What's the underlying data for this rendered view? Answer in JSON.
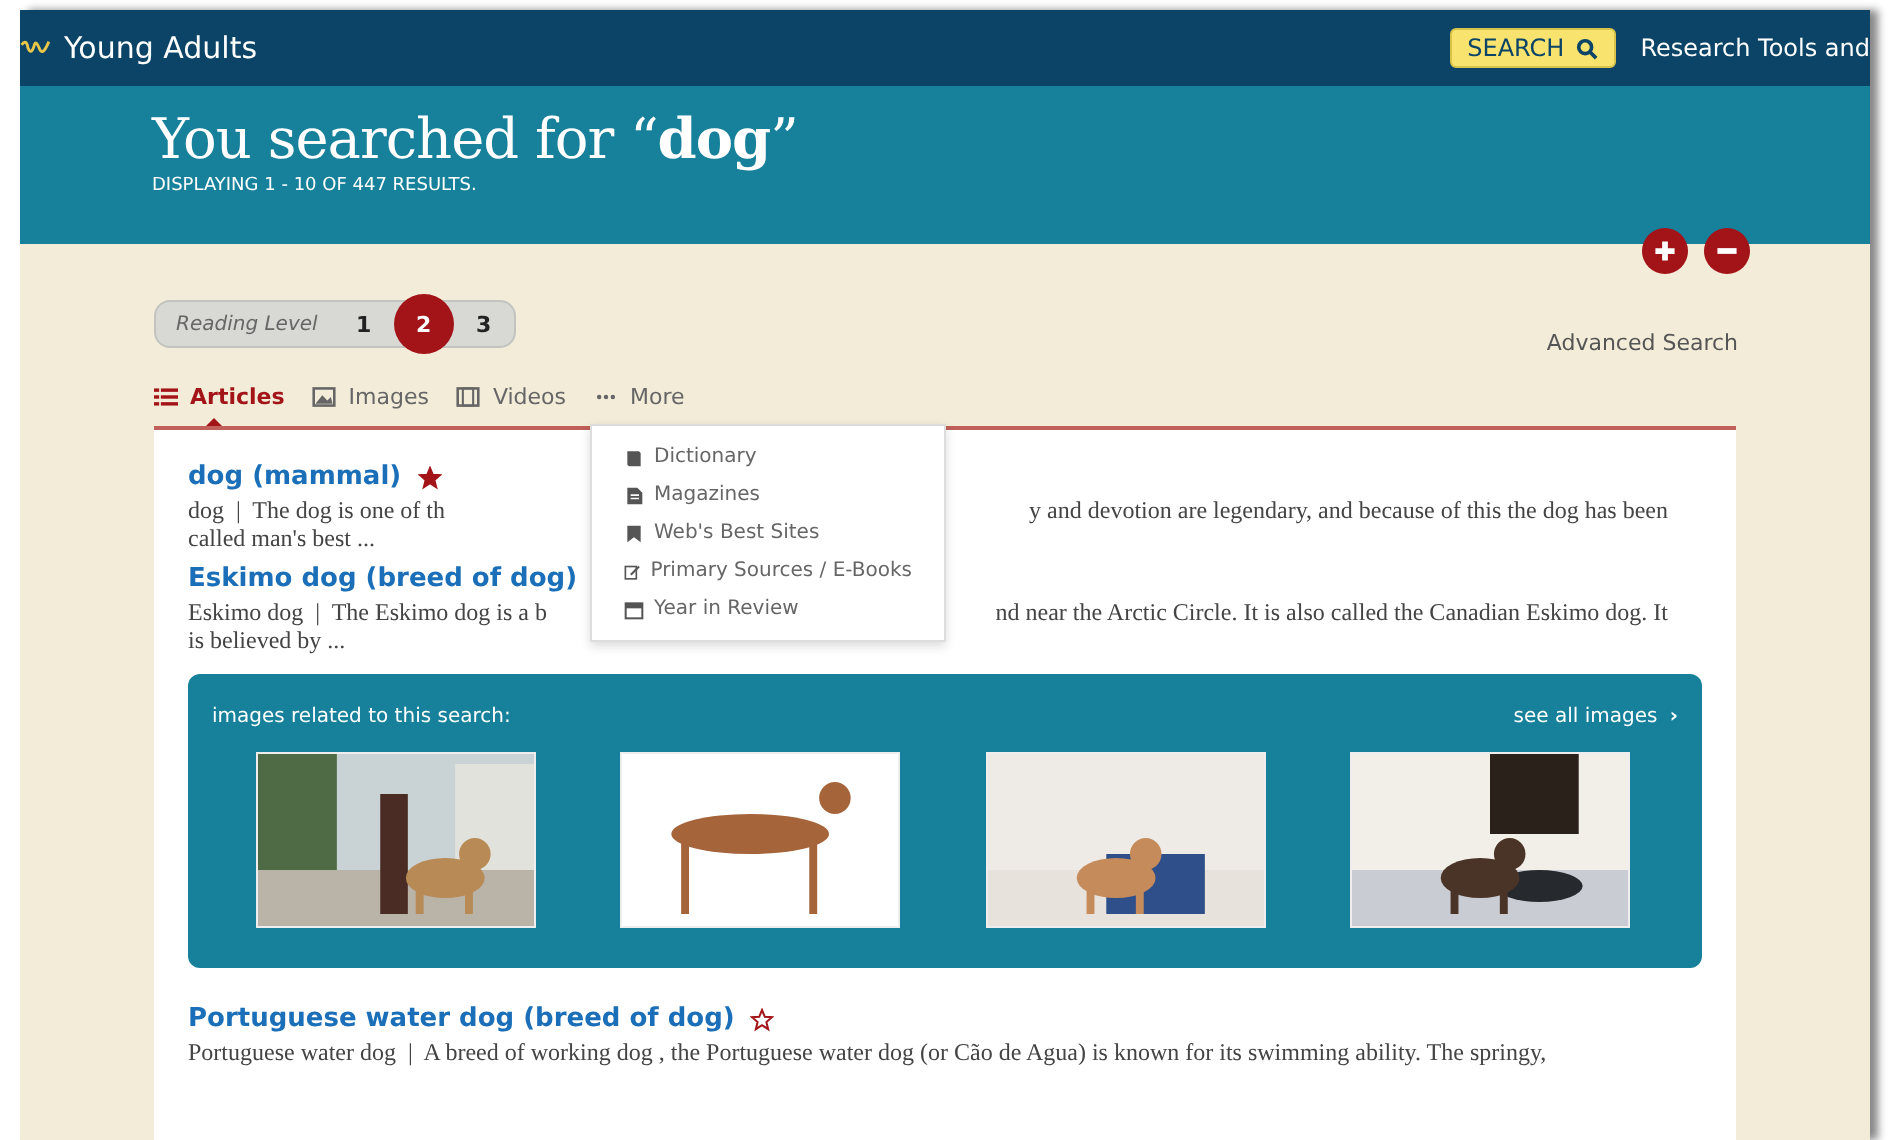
{
  "header": {
    "site": "Young Adults",
    "search_button": "SEARCH",
    "nav_link": "Research Tools and"
  },
  "banner": {
    "title": "You searched for “**dog**”",
    "results": "DISPLAYING 1 - 10 OF 447 RESULTS."
  },
  "reading_level": {
    "label": "Reading Level",
    "levels": [
      {
        "label": "1",
        "selected": false
      },
      {
        "label": "2",
        "selected": true
      },
      {
        "label": "3",
        "selected": false
      }
    ]
  },
  "advanced_search": "Advanced Search",
  "tabs": [
    {
      "label": "Articles",
      "selected": true
    },
    {
      "label": "Images",
      "selected": false
    },
    {
      "label": "Videos",
      "selected": false
    },
    {
      "label": "More",
      "selected": false
    }
  ],
  "more_menu": [
    {
      "label": "Dictionary"
    },
    {
      "label": "Magazines"
    },
    {
      "label": "Web's Best Sites"
    },
    {
      "label": "Primary Sources / E-Books"
    },
    {
      "label": "Year in Review"
    }
  ],
  "results": [
    {
      "title": "dog (mammal)",
      "starred": true,
      "snippet_start": "dog  |  The dog is one of th",
      "snippet_end": "y and devotion are legendary, and because of this the dog has been",
      "snippet_line2": "called man's best ..."
    },
    {
      "title": "Eskimo dog (breed of dog)",
      "snippet_start": "Eskimo dog  |  The Eskimo dog is a b",
      "snippet_end": "nd near the Arctic Circle. It is also called the Canadian Eskimo dog. It",
      "snippet_line2": "is believed by ..."
    }
  ],
  "images_panel": {
    "heading": "images related to this search:",
    "see_all": "see all images",
    "chevron": "›"
  },
  "more_results": [
    {
      "title": "Portuguese water dog (breed of dog)",
      "starred": false,
      "snippet": "Portuguese water dog  |  A breed of working dog , the Portuguese water dog (or Cão de Agua) is known for its swimming ability. The springy,"
    }
  ]
}
